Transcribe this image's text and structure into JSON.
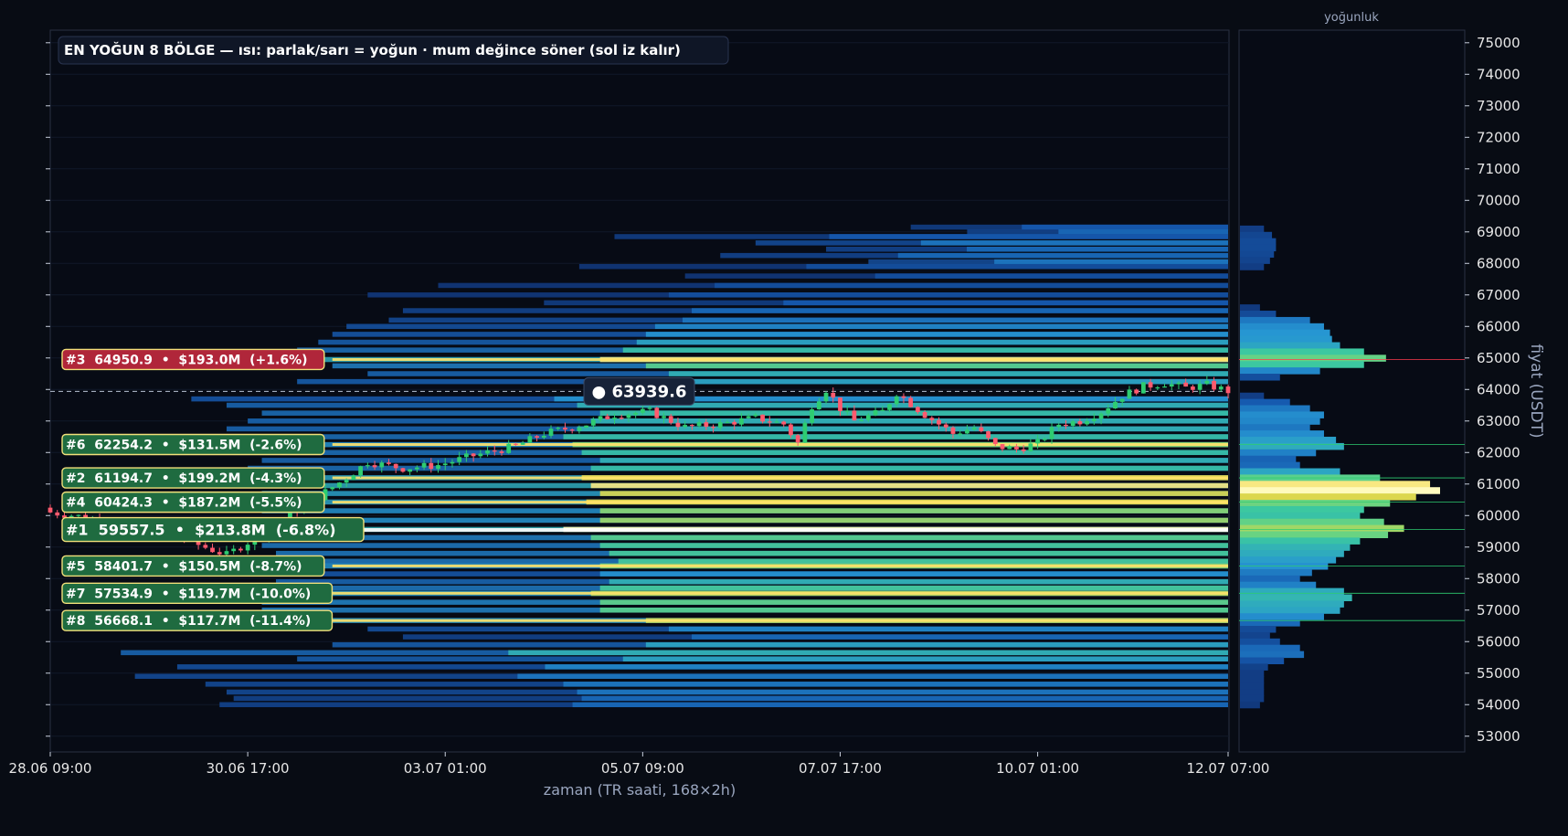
{
  "colors": {
    "background": "#080c14",
    "panel_border": "#2a3142",
    "axis_text": "#e6e6e6",
    "axis_label": "#9aa6bf",
    "bull": "#2ecc71",
    "bear": "#ff5a6e",
    "res_label_bg": "#b0263a",
    "sup_label_bg": "#1f6b40",
    "label_border": "#f1e07a",
    "price_tag_bg": "#172238"
  },
  "chart_data": [
    {
      "type": "candlestick",
      "title": "EN YOĞUN 8 BÖLGE — ısı: parlak/sarı = yoğun · mum değince söner (sol iz kalır)",
      "xlabel": "zaman (TR saati, 168×2h)",
      "ylabel": "fiyat (USDT)",
      "ylim": [
        52500,
        75400
      ],
      "x_tick_labels": [
        "28.06 09:00",
        "30.06 17:00",
        "03.07 01:00",
        "05.07 09:00",
        "07.07 17:00",
        "10.07 01:00",
        "12.07 07:00"
      ],
      "x_tick_index": [
        0,
        28,
        56,
        84,
        112,
        140,
        167
      ],
      "y_ticks": [
        53000,
        54000,
        55000,
        56000,
        57000,
        58000,
        59000,
        60000,
        61000,
        62000,
        63000,
        64000,
        65000,
        66000,
        67000,
        68000,
        69000,
        70000,
        71000,
        72000,
        73000,
        74000,
        75000
      ],
      "candle_count": 168,
      "close_anchors": [
        [
          0,
          60100
        ],
        [
          5,
          59950
        ],
        [
          10,
          59600
        ],
        [
          15,
          59750
        ],
        [
          20,
          59150
        ],
        [
          25,
          58750
        ],
        [
          28,
          59150
        ],
        [
          33,
          59900
        ],
        [
          38,
          60600
        ],
        [
          42,
          61200
        ],
        [
          45,
          61700
        ],
        [
          50,
          61500
        ],
        [
          55,
          61600
        ],
        [
          60,
          61900
        ],
        [
          66,
          62200
        ],
        [
          70,
          62600
        ],
        [
          76,
          62900
        ],
        [
          80,
          63200
        ],
        [
          85,
          63300
        ],
        [
          90,
          62800
        ],
        [
          95,
          62900
        ],
        [
          100,
          63100
        ],
        [
          104,
          62900
        ],
        [
          106,
          62300
        ],
        [
          108,
          63500
        ],
        [
          110,
          64000
        ],
        [
          112,
          63400
        ],
        [
          114,
          63000
        ],
        [
          118,
          63300
        ],
        [
          120,
          63900
        ],
        [
          124,
          63200
        ],
        [
          128,
          62600
        ],
        [
          131,
          62800
        ],
        [
          134,
          62200
        ],
        [
          137,
          62100
        ],
        [
          140,
          62300
        ],
        [
          143,
          62900
        ],
        [
          146,
          63000
        ],
        [
          149,
          63300
        ],
        [
          152,
          63800
        ],
        [
          155,
          64100
        ],
        [
          158,
          64200
        ],
        [
          161,
          64050
        ],
        [
          164,
          64150
        ],
        [
          167,
          63950
        ]
      ],
      "last_price": 63939.6,
      "last_price_label": "● 63939.6",
      "zones": [
        {
          "rank": "#1",
          "price": 59557.5,
          "volume": "$213.8M",
          "pct": "-6.8%",
          "label": "#1  59557.5  •  $213.8M  (-6.8%)",
          "kind": "support"
        },
        {
          "rank": "#2",
          "price": 61194.7,
          "volume": "$199.2M",
          "pct": "-4.3%",
          "label": "#2  61194.7  •  $199.2M  (-4.3%)",
          "kind": "support"
        },
        {
          "rank": "#3",
          "price": 64950.9,
          "volume": "$193.0M",
          "pct": "+1.6%",
          "label": "#3  64950.9  •  $193.0M  (+1.6%)",
          "kind": "resistance"
        },
        {
          "rank": "#4",
          "price": 60424.3,
          "volume": "$187.2M",
          "pct": "-5.5%",
          "label": "#4  60424.3  •  $187.2M  (-5.5%)",
          "kind": "support"
        },
        {
          "rank": "#5",
          "price": 58401.7,
          "volume": "$150.5M",
          "pct": "-8.7%",
          "label": "#5  58401.7  •  $150.5M  (-8.7%)",
          "kind": "support"
        },
        {
          "rank": "#6",
          "price": 62254.2,
          "volume": "$131.5M",
          "pct": "-2.6%",
          "label": "#6  62254.2  •  $131.5M  (-2.6%)",
          "kind": "support"
        },
        {
          "rank": "#7",
          "price": 57534.9,
          "volume": "$119.7M",
          "pct": "-10.0%",
          "label": "#7  57534.9  •  $119.7M  (-10.0%)",
          "kind": "support"
        },
        {
          "rank": "#8",
          "price": 56668.1,
          "volume": "$117.7M",
          "pct": "-11.4%",
          "label": "#8  56668.1  •  $117.7M  (-11.4%)",
          "kind": "support"
        }
      ],
      "heat_bands": [
        {
          "price": 69150,
          "start": 122,
          "density": 0.25
        },
        {
          "price": 69000,
          "start": 130,
          "density": 0.3
        },
        {
          "price": 68850,
          "start": 80,
          "density": 0.25
        },
        {
          "price": 68650,
          "start": 100,
          "density": 0.35
        },
        {
          "price": 68450,
          "start": 110,
          "density": 0.3
        },
        {
          "price": 68250,
          "start": 95,
          "density": 0.3
        },
        {
          "price": 68050,
          "start": 116,
          "density": 0.35
        },
        {
          "price": 67900,
          "start": 75,
          "density": 0.2
        },
        {
          "price": 67600,
          "start": 90,
          "density": 0.2
        },
        {
          "price": 67300,
          "start": 55,
          "density": 0.2
        },
        {
          "price": 67000,
          "start": 45,
          "density": 0.2
        },
        {
          "price": 66750,
          "start": 70,
          "density": 0.25
        },
        {
          "price": 66500,
          "start": 50,
          "density": 0.3
        },
        {
          "price": 66200,
          "start": 48,
          "density": 0.35
        },
        {
          "price": 66000,
          "start": 42,
          "density": 0.4
        },
        {
          "price": 65750,
          "start": 40,
          "density": 0.45
        },
        {
          "price": 65500,
          "start": 38,
          "density": 0.5
        },
        {
          "price": 65250,
          "start": 35,
          "density": 0.6
        },
        {
          "price": 64950,
          "start": 30,
          "density": 0.95
        },
        {
          "price": 64750,
          "start": 40,
          "density": 0.7
        },
        {
          "price": 64500,
          "start": 45,
          "density": 0.55
        },
        {
          "price": 64250,
          "start": 35,
          "density": 0.5
        },
        {
          "price": 63700,
          "start": 20,
          "density": 0.45
        },
        {
          "price": 63500,
          "start": 25,
          "density": 0.55
        },
        {
          "price": 63250,
          "start": 30,
          "density": 0.6
        },
        {
          "price": 63000,
          "start": 28,
          "density": 0.55
        },
        {
          "price": 62750,
          "start": 25,
          "density": 0.55
        },
        {
          "price": 62500,
          "start": 22,
          "density": 0.6
        },
        {
          "price": 62250,
          "start": 24,
          "density": 0.8
        },
        {
          "price": 62000,
          "start": 26,
          "density": 0.6
        },
        {
          "price": 61750,
          "start": 30,
          "density": 0.55
        },
        {
          "price": 61500,
          "start": 28,
          "density": 0.6
        },
        {
          "price": 61200,
          "start": 26,
          "density": 0.9
        },
        {
          "price": 60950,
          "start": 28,
          "density": 0.95
        },
        {
          "price": 60700,
          "start": 30,
          "density": 0.88
        },
        {
          "price": 60430,
          "start": 27,
          "density": 0.9
        },
        {
          "price": 60150,
          "start": 30,
          "density": 0.8
        },
        {
          "price": 59850,
          "start": 30,
          "density": 0.82
        },
        {
          "price": 59560,
          "start": 22,
          "density": 1.0
        },
        {
          "price": 59300,
          "start": 28,
          "density": 0.7
        },
        {
          "price": 59050,
          "start": 30,
          "density": 0.65
        },
        {
          "price": 58800,
          "start": 32,
          "density": 0.65
        },
        {
          "price": 58550,
          "start": 34,
          "density": 0.65
        },
        {
          "price": 58400,
          "start": 30,
          "density": 0.8
        },
        {
          "price": 58150,
          "start": 30,
          "density": 0.45
        },
        {
          "price": 57900,
          "start": 32,
          "density": 0.55
        },
        {
          "price": 57700,
          "start": 30,
          "density": 0.65
        },
        {
          "price": 57530,
          "start": 28,
          "density": 0.85
        },
        {
          "price": 57250,
          "start": 30,
          "density": 0.72
        },
        {
          "price": 57000,
          "start": 30,
          "density": 0.7
        },
        {
          "price": 56670,
          "start": 40,
          "density": 0.85
        },
        {
          "price": 56400,
          "start": 45,
          "density": 0.4
        },
        {
          "price": 56150,
          "start": 50,
          "density": 0.3
        },
        {
          "price": 55900,
          "start": 40,
          "density": 0.5
        },
        {
          "price": 55650,
          "start": 10,
          "density": 0.55
        },
        {
          "price": 55450,
          "start": 35,
          "density": 0.5
        },
        {
          "price": 55200,
          "start": 18,
          "density": 0.4
        },
        {
          "price": 54900,
          "start": 12,
          "density": 0.35
        },
        {
          "price": 54650,
          "start": 22,
          "density": 0.35
        },
        {
          "price": 54400,
          "start": 25,
          "density": 0.35
        },
        {
          "price": 54200,
          "start": 26,
          "density": 0.3
        },
        {
          "price": 54000,
          "start": 24,
          "density": 0.3
        }
      ]
    },
    {
      "type": "horizontal-bar",
      "title": "yoğunluk",
      "profile": [
        {
          "price": 69100,
          "value": 0.12
        },
        {
          "price": 68900,
          "value": 0.16
        },
        {
          "price": 68700,
          "value": 0.18
        },
        {
          "price": 68500,
          "value": 0.18
        },
        {
          "price": 68300,
          "value": 0.17
        },
        {
          "price": 68100,
          "value": 0.15
        },
        {
          "price": 67900,
          "value": 0.12
        },
        {
          "price": 66600,
          "value": 0.1
        },
        {
          "price": 66400,
          "value": 0.18
        },
        {
          "price": 66200,
          "value": 0.35
        },
        {
          "price": 66000,
          "value": 0.42
        },
        {
          "price": 65800,
          "value": 0.45
        },
        {
          "price": 65600,
          "value": 0.46
        },
        {
          "price": 65400,
          "value": 0.5
        },
        {
          "price": 65200,
          "value": 0.62
        },
        {
          "price": 65000,
          "value": 0.73
        },
        {
          "price": 64800,
          "value": 0.62
        },
        {
          "price": 64600,
          "value": 0.4
        },
        {
          "price": 64400,
          "value": 0.2
        },
        {
          "price": 63800,
          "value": 0.12
        },
        {
          "price": 63600,
          "value": 0.25
        },
        {
          "price": 63400,
          "value": 0.35
        },
        {
          "price": 63200,
          "value": 0.42
        },
        {
          "price": 63000,
          "value": 0.4
        },
        {
          "price": 62800,
          "value": 0.35
        },
        {
          "price": 62600,
          "value": 0.42
        },
        {
          "price": 62400,
          "value": 0.48
        },
        {
          "price": 62200,
          "value": 0.52
        },
        {
          "price": 62000,
          "value": 0.38
        },
        {
          "price": 61800,
          "value": 0.28
        },
        {
          "price": 61600,
          "value": 0.3
        },
        {
          "price": 61400,
          "value": 0.5
        },
        {
          "price": 61200,
          "value": 0.7
        },
        {
          "price": 61000,
          "value": 0.95
        },
        {
          "price": 60800,
          "value": 1.0
        },
        {
          "price": 60600,
          "value": 0.88
        },
        {
          "price": 60400,
          "value": 0.75
        },
        {
          "price": 60200,
          "value": 0.62
        },
        {
          "price": 60000,
          "value": 0.6
        },
        {
          "price": 59800,
          "value": 0.72
        },
        {
          "price": 59600,
          "value": 0.82
        },
        {
          "price": 59400,
          "value": 0.74
        },
        {
          "price": 59200,
          "value": 0.6
        },
        {
          "price": 59000,
          "value": 0.55
        },
        {
          "price": 58800,
          "value": 0.52
        },
        {
          "price": 58600,
          "value": 0.48
        },
        {
          "price": 58400,
          "value": 0.44
        },
        {
          "price": 58200,
          "value": 0.36
        },
        {
          "price": 58000,
          "value": 0.3
        },
        {
          "price": 57800,
          "value": 0.38
        },
        {
          "price": 57600,
          "value": 0.52
        },
        {
          "price": 57400,
          "value": 0.56
        },
        {
          "price": 57200,
          "value": 0.52
        },
        {
          "price": 57000,
          "value": 0.5
        },
        {
          "price": 56800,
          "value": 0.42
        },
        {
          "price": 56600,
          "value": 0.3
        },
        {
          "price": 56400,
          "value": 0.18
        },
        {
          "price": 56200,
          "value": 0.15
        },
        {
          "price": 56000,
          "value": 0.2
        },
        {
          "price": 55800,
          "value": 0.3
        },
        {
          "price": 55600,
          "value": 0.32
        },
        {
          "price": 55400,
          "value": 0.22
        },
        {
          "price": 55200,
          "value": 0.14
        },
        {
          "price": 55000,
          "value": 0.12
        },
        {
          "price": 54800,
          "value": 0.12
        },
        {
          "price": 54600,
          "value": 0.12
        },
        {
          "price": 54400,
          "value": 0.12
        },
        {
          "price": 54200,
          "value": 0.12
        },
        {
          "price": 54000,
          "value": 0.1
        }
      ]
    }
  ]
}
